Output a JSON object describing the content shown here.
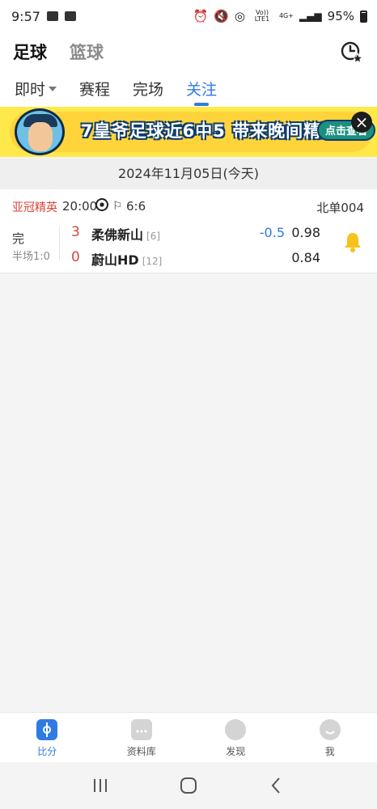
{
  "status_bar": {
    "time": "9:57",
    "network_volte": "Vo)) LTE1",
    "network_type": "4G+",
    "battery": "95%"
  },
  "sport_tabs": [
    {
      "label": "足球",
      "active": true
    },
    {
      "label": "篮球",
      "active": false
    }
  ],
  "sub_tabs": [
    {
      "label": "即时",
      "active": false
    },
    {
      "label": "赛程",
      "active": false
    },
    {
      "label": "完场",
      "active": false
    },
    {
      "label": "关注",
      "active": true
    }
  ],
  "banner": {
    "headline": "7皇爷足球近6中5 带来晚间精选",
    "cta": "点击查看"
  },
  "date_header": "2024年11月05日(今天)",
  "match": {
    "league": "亚冠精英",
    "time": "20:00",
    "corners": "6:6",
    "code": "北单004",
    "status": "完",
    "half_time": "半场1:0",
    "home": {
      "score": "3",
      "name": "柔佛新山",
      "rank": "[6]",
      "odds": "0.98"
    },
    "away": {
      "score": "0",
      "name": "蔚山HD",
      "rank": "[12]",
      "odds": "0.84"
    },
    "handicap": "-0.5"
  },
  "bottom_tabs": [
    {
      "label": "比分",
      "icon": "score-icon",
      "active": true
    },
    {
      "label": "资料库",
      "icon": "folder-icon",
      "active": false
    },
    {
      "label": "发现",
      "icon": "discover-icon",
      "active": false
    },
    {
      "label": "我",
      "icon": "profile-icon",
      "active": false
    }
  ],
  "colors": {
    "accent": "#2f7be3",
    "league_red": "#d9443a",
    "banner_yellow": "#ffe94a",
    "bell_yellow": "#f6c21c"
  }
}
